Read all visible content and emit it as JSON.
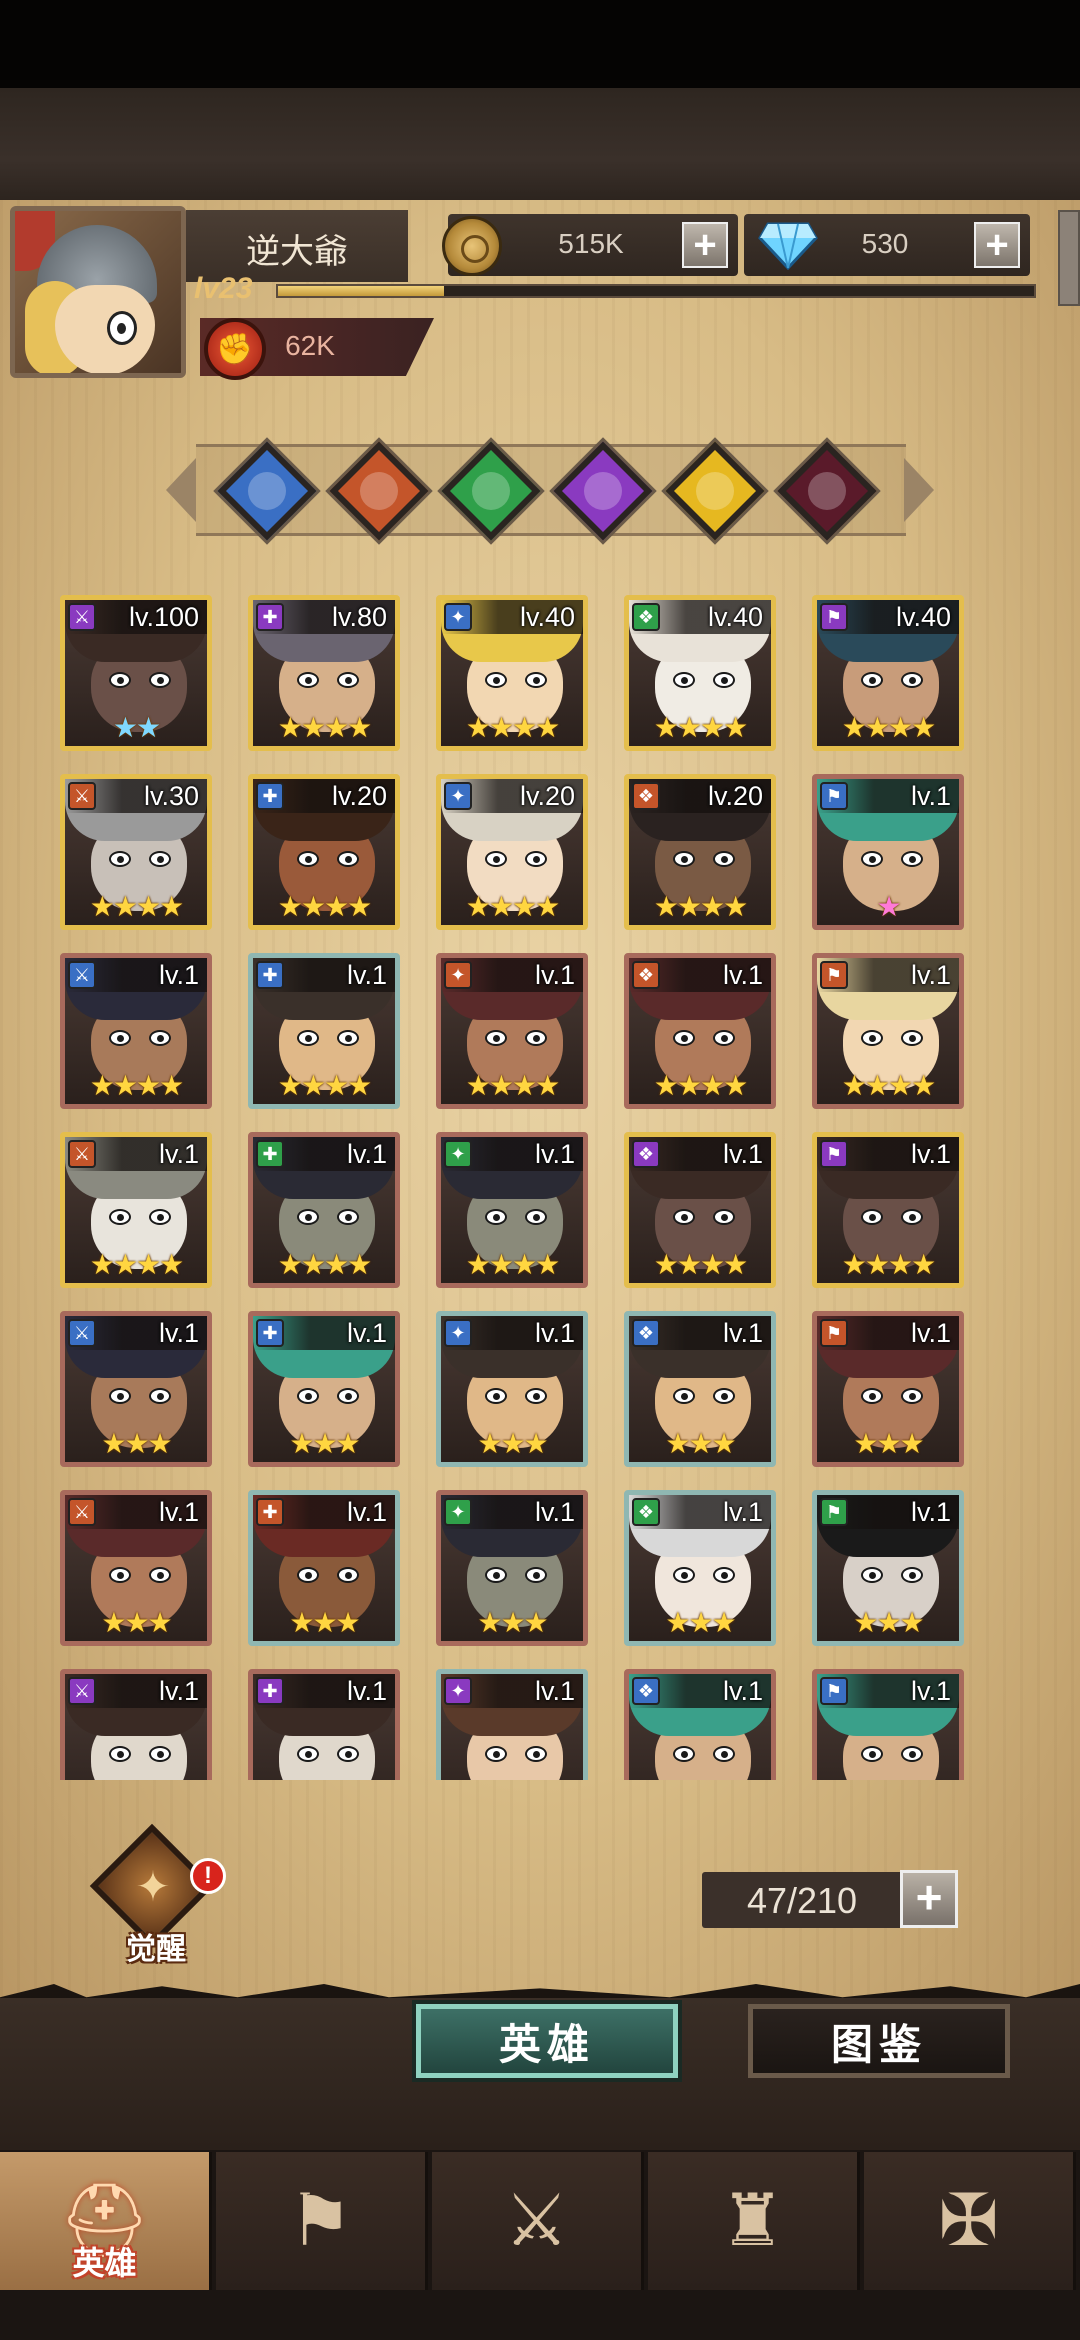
{
  "header": {
    "player_name": "逆大爺",
    "level": "lv23",
    "exp_fraction": 0.22,
    "power": "62K",
    "gold": "515K",
    "gems": "530"
  },
  "element_filters": [
    {
      "name": "sky-element",
      "color": "#3a6fc4"
    },
    {
      "name": "fire-element",
      "color": "#c4552a"
    },
    {
      "name": "nature-element",
      "color": "#2fa04a"
    },
    {
      "name": "arcane-element",
      "color": "#8a3ac0"
    },
    {
      "name": "light-element",
      "color": "#e6b820"
    },
    {
      "name": "dark-element",
      "color": "#5a1a2a"
    }
  ],
  "heroes": [
    {
      "level": "lv.100",
      "stars": "★★",
      "frame": "gold",
      "badge": "#8a3ac0",
      "hair": "#3a2a24",
      "skin": "#6a5048",
      "star_color": "#7fd8ff"
    },
    {
      "level": "lv.80",
      "stars": "★★★★",
      "frame": "gold",
      "badge": "#8a3ac0",
      "hair": "#6a6470",
      "skin": "#d6b08a"
    },
    {
      "level": "lv.40",
      "stars": "★★★★",
      "frame": "gold",
      "badge": "#3a6fc4",
      "hair": "#e8c84a",
      "skin": "#f2d7b2"
    },
    {
      "level": "lv.40",
      "stars": "★★★★",
      "frame": "gold",
      "badge": "#2fa04a",
      "hair": "#e8e2d8",
      "skin": "#f0ece4"
    },
    {
      "level": "lv.40",
      "stars": "★★★★",
      "frame": "gold",
      "badge": "#8a3ac0",
      "hair": "#2a4a5a",
      "skin": "#c89c7a"
    },
    {
      "level": "lv.30",
      "stars": "★★★★",
      "frame": "gold",
      "badge": "#c4552a",
      "hair": "#9a9a9a",
      "skin": "#c8c0b8"
    },
    {
      "level": "lv.20",
      "stars": "★★★★",
      "frame": "gold",
      "badge": "#3a6fc4",
      "hair": "#3a2418",
      "skin": "#9a5a3a"
    },
    {
      "level": "lv.20",
      "stars": "★★★★",
      "frame": "gold",
      "badge": "#3a6fc4",
      "hair": "#d8d2c4",
      "skin": "#f2dcc2"
    },
    {
      "level": "lv.20",
      "stars": "★★★★",
      "frame": "gold",
      "badge": "#c4552a",
      "hair": "#2a2220",
      "skin": "#7a5a44"
    },
    {
      "level": "lv.1",
      "stars": "★",
      "frame": "red",
      "badge": "#3a6fc4",
      "hair": "#3aa08a",
      "skin": "#d6b08a",
      "star_color": "#ff7ad8"
    },
    {
      "level": "lv.1",
      "stars": "★★★★",
      "frame": "red",
      "badge": "#3a6fc4",
      "hair": "#2a2a3a",
      "skin": "#a87a5a"
    },
    {
      "level": "lv.1",
      "stars": "★★★★",
      "frame": "teal",
      "badge": "#3a6fc4",
      "hair": "#3a302a",
      "skin": "#e0b888"
    },
    {
      "level": "lv.1",
      "stars": "★★★★",
      "frame": "red",
      "badge": "#c4552a",
      "hair": "#5a2a2a",
      "skin": "#b07a5a"
    },
    {
      "level": "lv.1",
      "stars": "★★★★",
      "frame": "red",
      "badge": "#c4552a",
      "hair": "#5a2a2a",
      "skin": "#b07a5a"
    },
    {
      "level": "lv.1",
      "stars": "★★★★",
      "frame": "red",
      "badge": "#c4552a",
      "hair": "#e8d6a0",
      "skin": "#f2d7b2"
    },
    {
      "level": "lv.1",
      "stars": "★★★★",
      "frame": "gold",
      "badge": "#c4552a",
      "hair": "#8a8a80",
      "skin": "#e8e4dc"
    },
    {
      "level": "lv.1",
      "stars": "★★★★",
      "frame": "red",
      "badge": "#2fa04a",
      "hair": "#2a2a34",
      "skin": "#8a8a7a"
    },
    {
      "level": "lv.1",
      "stars": "★★★★",
      "frame": "red",
      "badge": "#2fa04a",
      "hair": "#2a2a34",
      "skin": "#8a8a7a"
    },
    {
      "level": "lv.1",
      "stars": "★★★★",
      "frame": "gold",
      "badge": "#8a3ac0",
      "hair": "#3a2a24",
      "skin": "#6a5048"
    },
    {
      "level": "lv.1",
      "stars": "★★★★",
      "frame": "gold",
      "badge": "#8a3ac0",
      "hair": "#3a2a24",
      "skin": "#6a5048"
    },
    {
      "level": "lv.1",
      "stars": "★★★",
      "frame": "red",
      "badge": "#3a6fc4",
      "hair": "#2a2a3a",
      "skin": "#a87a5a"
    },
    {
      "level": "lv.1",
      "stars": "★★★",
      "frame": "red",
      "badge": "#3a6fc4",
      "hair": "#3aa08a",
      "skin": "#d6b08a"
    },
    {
      "level": "lv.1",
      "stars": "★★★",
      "frame": "teal",
      "badge": "#3a6fc4",
      "hair": "#3a302a",
      "skin": "#e0b888"
    },
    {
      "level": "lv.1",
      "stars": "★★★",
      "frame": "teal",
      "badge": "#3a6fc4",
      "hair": "#3a302a",
      "skin": "#e0b888"
    },
    {
      "level": "lv.1",
      "stars": "★★★",
      "frame": "red",
      "badge": "#c4552a",
      "hair": "#5a2a2a",
      "skin": "#b07a5a"
    },
    {
      "level": "lv.1",
      "stars": "★★★",
      "frame": "red",
      "badge": "#c4552a",
      "hair": "#5a2a2a",
      "skin": "#b07a5a"
    },
    {
      "level": "lv.1",
      "stars": "★★★",
      "frame": "teal",
      "badge": "#c4552a",
      "hair": "#6a2a24",
      "skin": "#8a5a3a"
    },
    {
      "level": "lv.1",
      "stars": "★★★",
      "frame": "red",
      "badge": "#2fa04a",
      "hair": "#2a2a34",
      "skin": "#8a8a7a"
    },
    {
      "level": "lv.1",
      "stars": "★★★",
      "frame": "teal",
      "badge": "#2fa04a",
      "hair": "#d8d8d8",
      "skin": "#f0e6dc"
    },
    {
      "level": "lv.1",
      "stars": "★★★",
      "frame": "teal",
      "badge": "#2fa04a",
      "hair": "#1a1a1a",
      "skin": "#d8d0c8"
    },
    {
      "level": "lv.1",
      "stars": "",
      "frame": "red",
      "badge": "#8a3ac0",
      "hair": "#3a2a24",
      "skin": "#e0d8cc"
    },
    {
      "level": "lv.1",
      "stars": "",
      "frame": "red",
      "badge": "#8a3ac0",
      "hair": "#3a2a24",
      "skin": "#e0d8cc"
    },
    {
      "level": "lv.1",
      "stars": "",
      "frame": "teal",
      "badge": "#8a3ac0",
      "hair": "#5a3a2a",
      "skin": "#e8c8a8"
    },
    {
      "level": "lv.1",
      "stars": "",
      "frame": "red",
      "badge": "#3a6fc4",
      "hair": "#3aa08a",
      "skin": "#d6b08a"
    },
    {
      "level": "lv.1",
      "stars": "",
      "frame": "red",
      "badge": "#3a6fc4",
      "hair": "#3aa08a",
      "skin": "#d6b08a"
    }
  ],
  "awaken": {
    "label": "觉醒",
    "alert": "!"
  },
  "capacity": "47/210",
  "view_tabs": {
    "heroes": "英雄",
    "codex": "图鉴"
  },
  "bottom_nav": [
    {
      "name": "nav-heroes",
      "label": "英雄",
      "glyph": "⛑"
    },
    {
      "name": "nav-adventure",
      "label": "",
      "glyph": "⚑"
    },
    {
      "name": "nav-battle",
      "label": "",
      "glyph": "⚔"
    },
    {
      "name": "nav-castle",
      "label": "",
      "glyph": "♜"
    },
    {
      "name": "nav-guild",
      "label": "",
      "glyph": "✠"
    }
  ]
}
